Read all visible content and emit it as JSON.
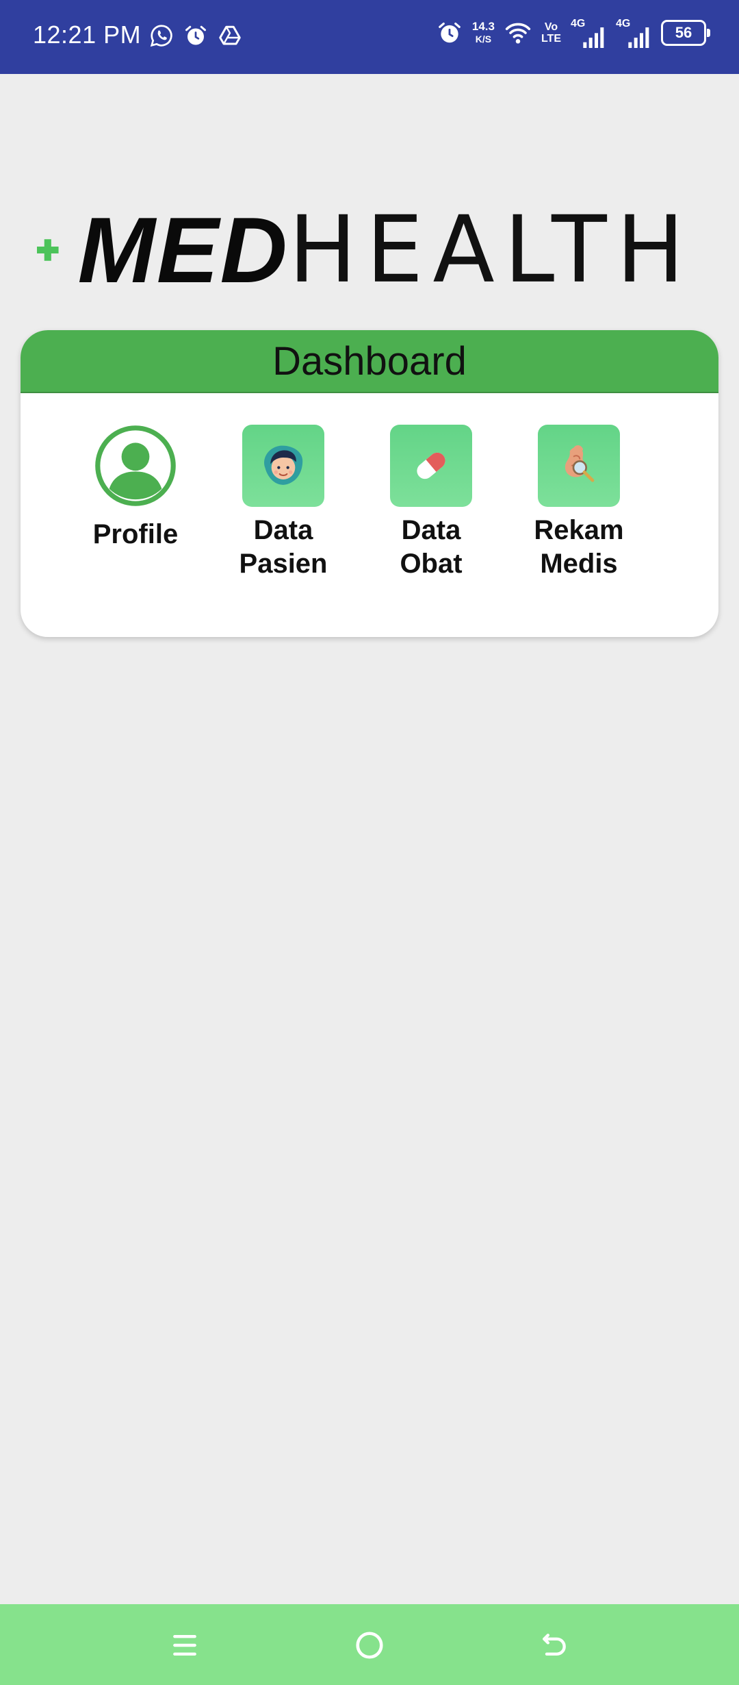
{
  "status_bar": {
    "time": "12:21 PM",
    "left_icons": [
      "whatsapp-icon",
      "alarm-icon",
      "drive-icon"
    ],
    "alarm_icon": "alarm-icon",
    "speed_value": "14.3",
    "speed_unit": "K/S",
    "volte_top": "Vo",
    "volte_bottom": "LTE",
    "net1_tag": "4G",
    "net2_tag": "4G",
    "battery": "56",
    "color": "#303f9f"
  },
  "logo": {
    "part1": "MED",
    "part2": "HEALTH",
    "cross_color": "#4cc35a"
  },
  "dashboard": {
    "title": "Dashboard",
    "header_color": "#4caf50",
    "items": [
      {
        "label": "Profile",
        "icon": "profile-icon"
      },
      {
        "label": "Data\nPasien",
        "icon": "patient-icon"
      },
      {
        "label": "Data\nObat",
        "icon": "pill-icon"
      },
      {
        "label": "Rekam\nMedis",
        "icon": "medical-record-icon"
      }
    ]
  },
  "nav_bar": {
    "color": "#86e28c",
    "buttons": [
      "menu-icon",
      "home-icon",
      "back-icon"
    ]
  }
}
